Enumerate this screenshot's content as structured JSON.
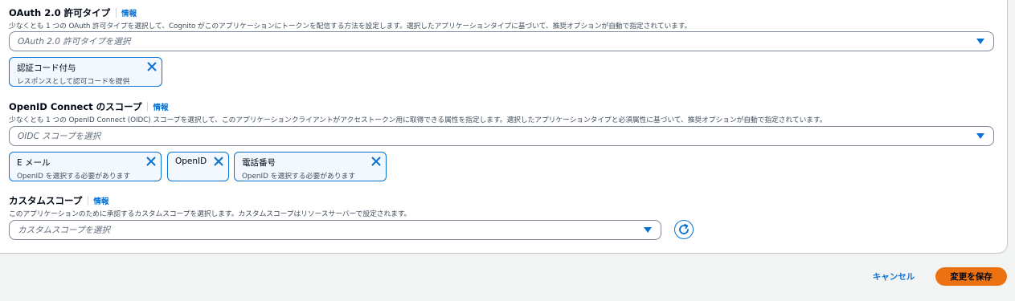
{
  "oauth": {
    "label": "OAuth 2.0 許可タイプ",
    "info": "情報",
    "description": "少なくとも 1 つの OAuth 許可タイプを選択して、Cognito がこのアプリケーションにトークンを配信する方法を設定します。選択したアプリケーションタイプに基づいて、推奨オプションが自動で指定されています。",
    "placeholder": "OAuth 2.0 許可タイプを選択",
    "tokens": [
      {
        "title": "認証コード付与",
        "subtitle": "レスポンスとして認可コードを提供"
      }
    ]
  },
  "oidc": {
    "label": "OpenID Connect のスコープ",
    "info": "情報",
    "description": "少なくとも 1 つの OpenID Connect (OIDC) スコープを選択して、このアプリケーションクライアントがアクセストークン用に取得できる属性を指定します。選択したアプリケーションタイプと必須属性に基づいて、推奨オプションが自動で指定されています。",
    "placeholder": "OIDC スコープを選択",
    "tokens": [
      {
        "title": "E メール",
        "subtitle": "OpenID を選択する必要があります"
      },
      {
        "title": "OpenID",
        "subtitle": ""
      },
      {
        "title": "電話番号",
        "subtitle": "OpenID を選択する必要があります"
      }
    ]
  },
  "custom": {
    "label": "カスタムスコープ",
    "info": "情報",
    "description": "このアプリケーションのために承認するカスタムスコープを選択します。カスタムスコープはリソースサーバーで設定されます。",
    "placeholder": "カスタムスコープを選択"
  },
  "footer": {
    "cancel_label": "キャンセル",
    "save_label": "変更を保存"
  },
  "colors": {
    "accent": "#0972d3",
    "primary_button": "#ec7211",
    "token_bg": "#f2f8fd"
  },
  "icons": {
    "dropdown": "caret-down-icon",
    "remove": "close-icon",
    "refresh": "refresh-icon"
  }
}
